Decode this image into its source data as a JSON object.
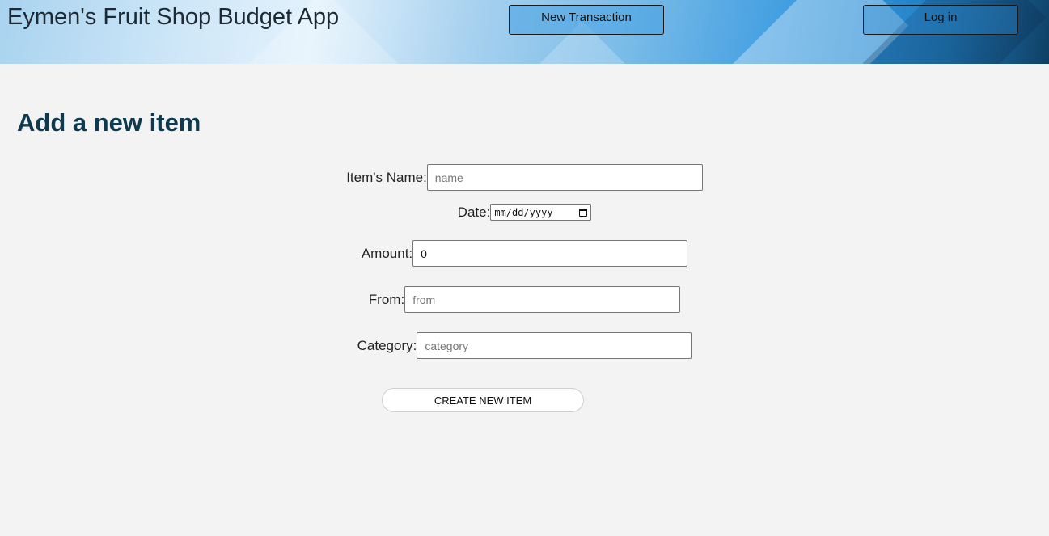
{
  "header": {
    "title": "Eymen's Fruit Shop Budget App",
    "nav": {
      "new_transaction": "New Transaction",
      "login": "Log in"
    }
  },
  "page": {
    "heading": "Add a new item"
  },
  "form": {
    "name": {
      "label": "Item's Name:",
      "placeholder": "name",
      "value": ""
    },
    "date": {
      "label": "Date:",
      "placeholder": "mm/dd/yyyy"
    },
    "amount": {
      "label": "Amount:",
      "value": "0"
    },
    "from": {
      "label": "From:",
      "placeholder": "from",
      "value": ""
    },
    "category": {
      "label": "Category:",
      "placeholder": "category",
      "value": ""
    },
    "submit_label": "CREATE NEW ITEM"
  },
  "icons": {
    "date_picker": "calendar-icon"
  }
}
